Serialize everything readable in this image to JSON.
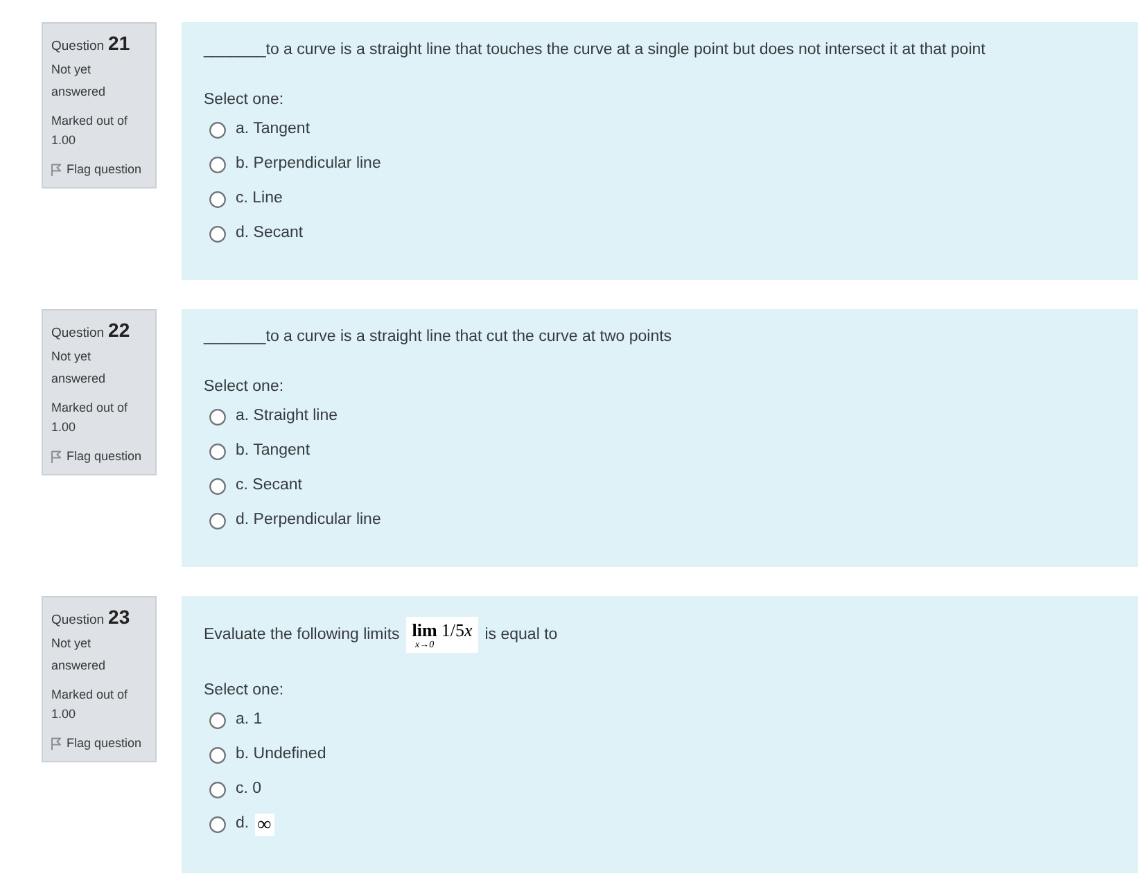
{
  "questions": [
    {
      "label": "Question",
      "number": "21",
      "state": "Not yet answered",
      "mark": "Marked out of 1.00",
      "flag": {
        "label": "Flag question",
        "flagged": false
      },
      "text": [
        {
          "kind": "text",
          "text": "_______to a curve is a straight line that touches the curve at a single point but does not intersect it at that point"
        }
      ],
      "prompt": "Select one:",
      "options": [
        {
          "kind": "text",
          "letter": "a.",
          "text": "Tangent",
          "selected": false
        },
        {
          "kind": "text",
          "letter": "b.",
          "text": "Perpendicular line",
          "selected": false
        },
        {
          "kind": "text",
          "letter": "c.",
          "text": "Line",
          "selected": false
        },
        {
          "kind": "text",
          "letter": "d.",
          "text": "Secant",
          "selected": false
        }
      ]
    },
    {
      "label": "Question",
      "number": "22",
      "state": "Not yet answered",
      "mark": "Marked out of 1.00",
      "flag": {
        "label": "Flag question",
        "flagged": false
      },
      "text": [
        {
          "kind": "text",
          "text": "_______to a curve is a straight line that cut the curve at two points"
        }
      ],
      "prompt": "Select one:",
      "options": [
        {
          "kind": "text",
          "letter": "a.",
          "text": "Straight line",
          "selected": false
        },
        {
          "kind": "text",
          "letter": "b.",
          "text": "Tangent",
          "selected": false
        },
        {
          "kind": "text",
          "letter": "c.",
          "text": "Secant",
          "selected": false
        },
        {
          "kind": "text",
          "letter": "d.",
          "text": "Perpendicular line",
          "selected": false
        }
      ]
    },
    {
      "label": "Question",
      "number": "23",
      "state": "Not yet answered",
      "mark": "Marked out of 1.00",
      "flag": {
        "label": "Flag question",
        "flagged": false
      },
      "text": [
        {
          "kind": "text",
          "text": "Evaluate the following limits"
        },
        {
          "kind": "math",
          "operator": "lim",
          "subscript": "x→0",
          "coefficient": "1/5",
          "variable": "x"
        },
        {
          "kind": "text",
          "text": "is equal to"
        }
      ],
      "prompt": "Select one:",
      "options": [
        {
          "kind": "text",
          "letter": "a.",
          "text": "1",
          "selected": false
        },
        {
          "kind": "text",
          "letter": "b.",
          "text": "Undefined",
          "selected": false
        },
        {
          "kind": "text",
          "letter": "c.",
          "text": "0",
          "selected": false
        },
        {
          "kind": "math",
          "letter": "d.",
          "text": "∞",
          "selected": false
        }
      ]
    }
  ]
}
